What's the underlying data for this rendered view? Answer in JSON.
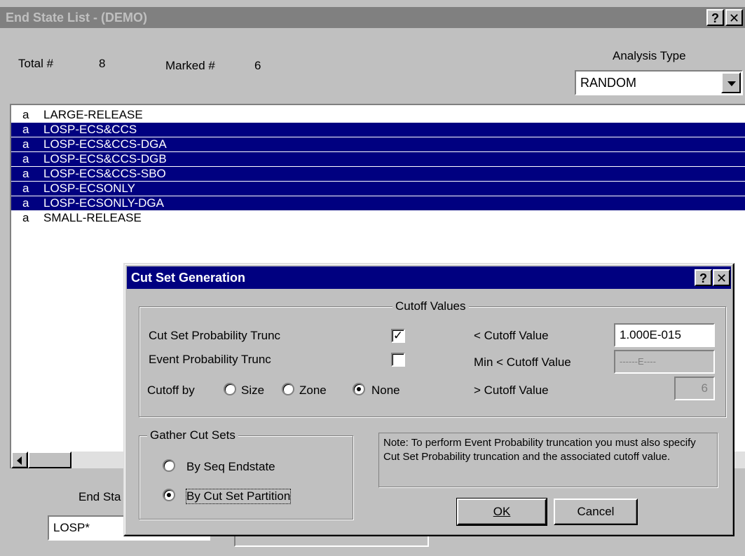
{
  "window": {
    "title": "End State List  -  (DEMO)",
    "help_btn": "?",
    "close_btn": "✕"
  },
  "header": {
    "total_label": "Total #",
    "total_value": "8",
    "marked_label": "Marked #",
    "marked_value": "6",
    "analysis_label": "Analysis Type",
    "analysis_value": "RANDOM"
  },
  "list": {
    "items": [
      {
        "mark": "a",
        "name": "LARGE-RELEASE",
        "selected": false
      },
      {
        "mark": "a",
        "name": "LOSP-ECS&CCS",
        "selected": true
      },
      {
        "mark": "a",
        "name": "LOSP-ECS&CCS-DGA",
        "selected": true
      },
      {
        "mark": "a",
        "name": "LOSP-ECS&CCS-DGB",
        "selected": true
      },
      {
        "mark": "a",
        "name": "LOSP-ECS&CCS-SBO",
        "selected": true
      },
      {
        "mark": "a",
        "name": "LOSP-ECSONLY",
        "selected": true
      },
      {
        "mark": "a",
        "name": "LOSP-ECSONLY-DGA",
        "selected": true
      },
      {
        "mark": "a",
        "name": "SMALL-RELEASE",
        "selected": false
      }
    ]
  },
  "footer": {
    "end_state_label": "End Sta",
    "filter_value": "LOSP*"
  },
  "dialog": {
    "title": "Cut Set Generation",
    "help_btn": "?",
    "close_btn": "✕",
    "cutoff_group_title": "Cutoff Values",
    "cut_set_prob_trunc_label": "Cut Set Probability Trunc",
    "cut_set_prob_trunc_checked": true,
    "event_prob_trunc_label": "Event Probability Trunc",
    "event_prob_trunc_checked": false,
    "cutoff_by_label": "Cutoff by",
    "cutoff_by_options": [
      "Size",
      "Zone",
      "None"
    ],
    "cutoff_by_selected": "None",
    "lt_cutoff_label": "< Cutoff Value",
    "lt_cutoff_value": "1.000E-015",
    "min_lt_cutoff_label": "Min < Cutoff Value",
    "min_lt_cutoff_value": "------E----",
    "gt_cutoff_label": "> Cutoff Value",
    "gt_cutoff_value": "6",
    "gather_group_title": "Gather Cut Sets",
    "gather_options": [
      "By Seq Endstate",
      "By Cut Set Partition"
    ],
    "gather_selected": "By Cut Set Partition",
    "note": "Note: To perform Event Probability truncation you must also specify Cut Set Probability truncation and the associated cutoff value.",
    "ok_label": "OK",
    "cancel_label": "Cancel"
  }
}
